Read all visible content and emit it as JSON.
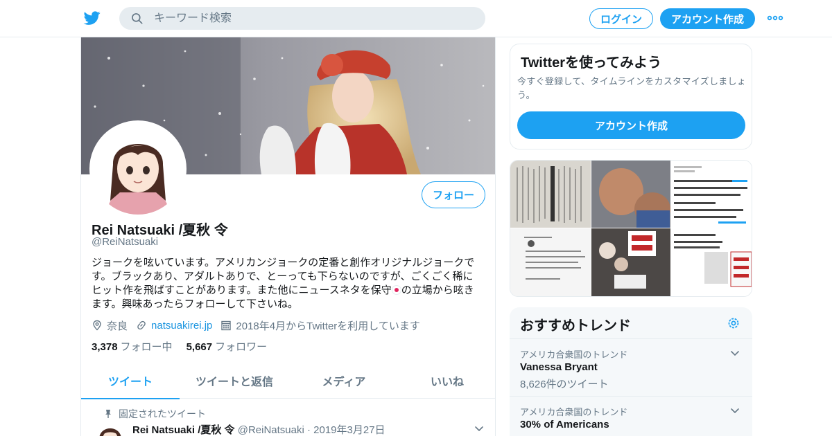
{
  "header": {
    "search_placeholder": "キーワード検索",
    "login_label": "ログイン",
    "signup_label": "アカウント作成"
  },
  "profile": {
    "name": "Rei Natsuaki /夏秋 令",
    "handle": "@ReiNatsuaki",
    "follow_label": "フォロー",
    "bio_before_flag": "ジョークを呟いています。アメリカンジョークの定番と創作オリジナルジョークです。ブラックあり、アダルトありで、とーっても下らないのですが、ごくごく稀にヒット作を飛ばすことがあります。また他にニュースネタを保守",
    "bio_after_flag": "の立場から呟きます。興味あったらフォローして下さいね。",
    "location": "奈良",
    "website": "natsuakirei.jp",
    "joined": "2018年4月からTwitterを利用しています",
    "following_count": "3,378",
    "following_label": "フォロー中",
    "followers_count": "5,667",
    "followers_label": "フォロワー"
  },
  "tabs": [
    {
      "label": "ツイート",
      "active": true
    },
    {
      "label": "ツイートと返信",
      "active": false
    },
    {
      "label": "メディア",
      "active": false
    },
    {
      "label": "いいね",
      "active": false
    }
  ],
  "pinned": {
    "label": "固定されたツイート",
    "name": "Rei Natsuaki /夏秋 令",
    "handle": "@ReiNatsuaki",
    "separator": "·",
    "date": "2019年3月27日"
  },
  "signup_card": {
    "title": "Twitterを使ってみよう",
    "text": "今すぐ登録して、タイムラインをカスタマイズしましょう。",
    "button_label": "アカウント作成"
  },
  "trends": {
    "title": "おすすめトレンド",
    "items": [
      {
        "context": "アメリカ合衆国のトレンド",
        "name": "Vanessa Bryant",
        "count": "8,626件のツイート"
      },
      {
        "context": "アメリカ合衆国のトレンド",
        "name": "30% of Americans",
        "count": ""
      }
    ]
  },
  "colors": {
    "accent": "#1da1f2",
    "text": "#14171a",
    "secondary": "#657786",
    "border": "#e6ecf0"
  },
  "icons": [
    "twitter-bird-icon",
    "search-icon",
    "more-dots-icon",
    "location-icon",
    "link-icon",
    "calendar-icon",
    "pin-icon",
    "chevron-down-icon",
    "gear-icon"
  ]
}
